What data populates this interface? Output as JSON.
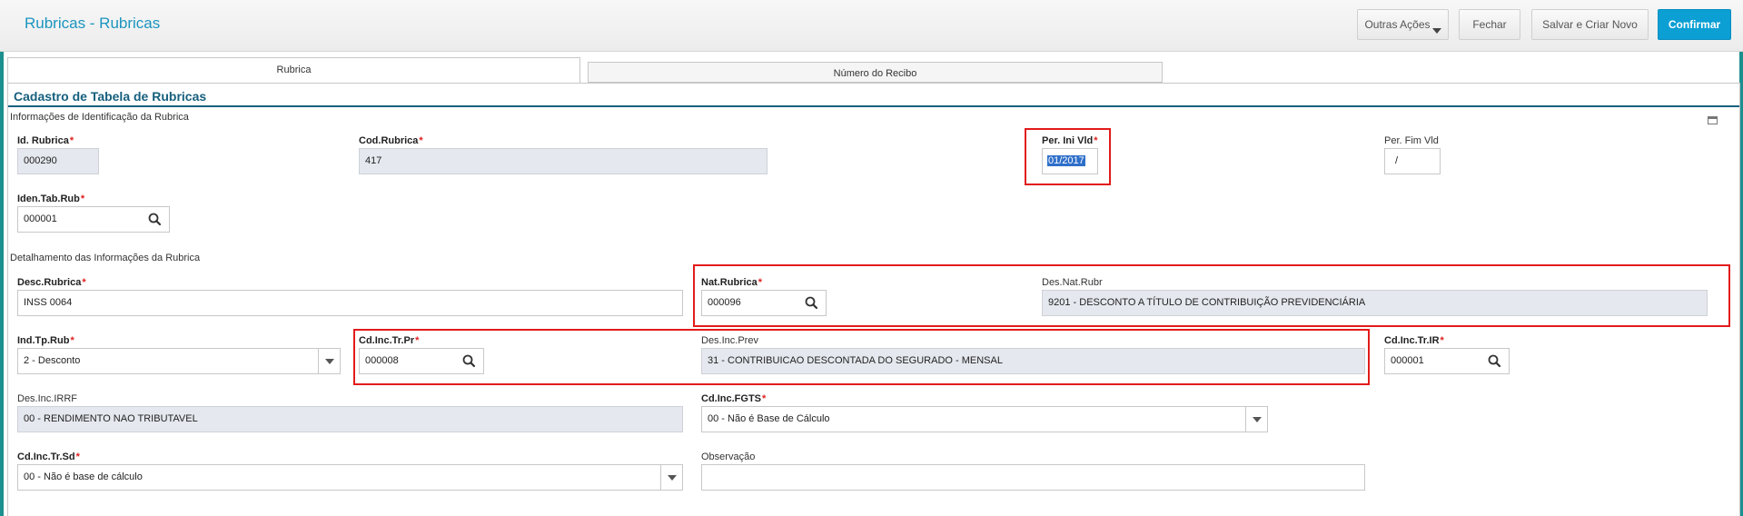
{
  "header": {
    "title": "Rubricas - Rubricas",
    "buttons": {
      "outras_acoes": "Outras Ações",
      "fechar": "Fechar",
      "salvar_criar_novo": "Salvar e Criar Novo",
      "confirmar": "Confirmar"
    }
  },
  "tabs": [
    {
      "label": "Rubrica",
      "active": true
    },
    {
      "label": "Número do Recibo",
      "active": false
    }
  ],
  "form": {
    "section_title": "Cadastro de Tabela de Rubricas",
    "group1_title": "Informações de Identificação da Rubrica",
    "group2_title": "Detalhamento das Informações da Rubrica",
    "fields": {
      "id_rubrica": {
        "label": "Id. Rubrica",
        "value": "000290",
        "required": true
      },
      "cod_rubrica": {
        "label": "Cod.Rubrica",
        "value": "417",
        "required": true
      },
      "per_ini_vld": {
        "label": "Per. Ini Vld",
        "value": "01/2017",
        "required": true
      },
      "per_fim_vld": {
        "label": "Per. Fim Vld",
        "value": "/",
        "required": false
      },
      "iden_tab_rub": {
        "label": "Iden.Tab.Rub",
        "value": "000001",
        "required": true
      },
      "desc_rubrica": {
        "label": "Desc.Rubrica",
        "value": "INSS 0064",
        "required": true
      },
      "nat_rubrica": {
        "label": "Nat.Rubrica",
        "value": "000096",
        "required": true
      },
      "des_nat_rubr": {
        "label": "Des.Nat.Rubr",
        "value": "9201 - DESCONTO A TÍTULO DE CONTRIBUIÇÃO PREVIDENCIÁRIA",
        "required": false
      },
      "ind_tp_rub": {
        "label": "Ind.Tp.Rub",
        "value": "2 - Desconto",
        "required": true
      },
      "cd_inc_tr_pr": {
        "label": "Cd.Inc.Tr.Pr",
        "value": "000008",
        "required": true
      },
      "des_inc_prev": {
        "label": "Des.Inc.Prev",
        "value": "31 - CONTRIBUICAO DESCONTADA DO SEGURADO - MENSAL",
        "required": false
      },
      "cd_inc_tr_ir": {
        "label": "Cd.Inc.Tr.IR",
        "value": "000001",
        "required": true
      },
      "des_inc_irrf": {
        "label": "Des.Inc.IRRF",
        "value": "00 - RENDIMENTO NAO TRIBUTAVEL",
        "required": false
      },
      "cd_inc_fgts": {
        "label": "Cd.Inc.FGTS",
        "value": "00 - Não é Base de Cálculo",
        "required": true
      },
      "cd_inc_tr_sd": {
        "label": "Cd.Inc.Tr.Sd",
        "value": "00 - Não é base de cálculo",
        "required": true
      },
      "observacao": {
        "label": "Observação",
        "value": "",
        "required": false
      }
    }
  },
  "colors": {
    "accent": "#1b95bf",
    "primary_button": "#0b9fd4",
    "section_title": "#16607e",
    "readonly_bg": "#e5e8ee",
    "required_star": "#e02020",
    "highlight_box": "#e21b1b"
  },
  "icons": [
    "search-icon",
    "chevron-down-icon",
    "collapse-icon"
  ]
}
